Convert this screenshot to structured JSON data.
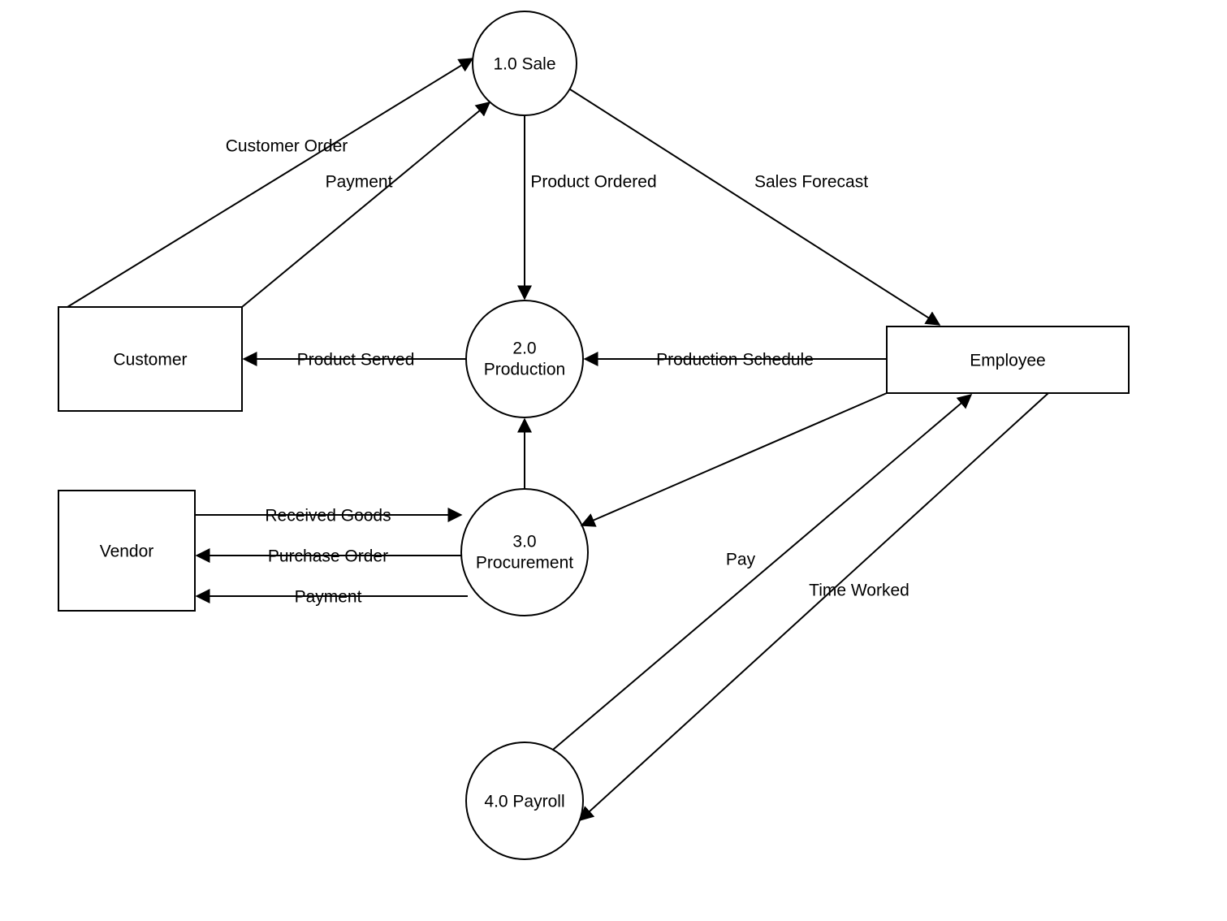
{
  "entities": {
    "customer": "Customer",
    "vendor": "Vendor",
    "employee": "Employee"
  },
  "processes": {
    "sale": {
      "line1": "1.0 Sale"
    },
    "production": {
      "line1": "2.0",
      "line2": "Production"
    },
    "procurement": {
      "line1": "3.0",
      "line2": "Procurement"
    },
    "payroll": {
      "line1": "4.0 Payroll"
    }
  },
  "flows": {
    "customer_order": "Customer Order",
    "payment_from_customer": "Payment",
    "product_ordered": "Product Ordered",
    "sales_forecast": "Sales Forecast",
    "product_served": "Product Served",
    "production_schedule": "Production Schedule",
    "received_goods": "Received Goods",
    "purchase_order": "Purchase Order",
    "payment_to_vendor": "Payment",
    "pay": "Pay",
    "time_worked": "Time Worked"
  }
}
